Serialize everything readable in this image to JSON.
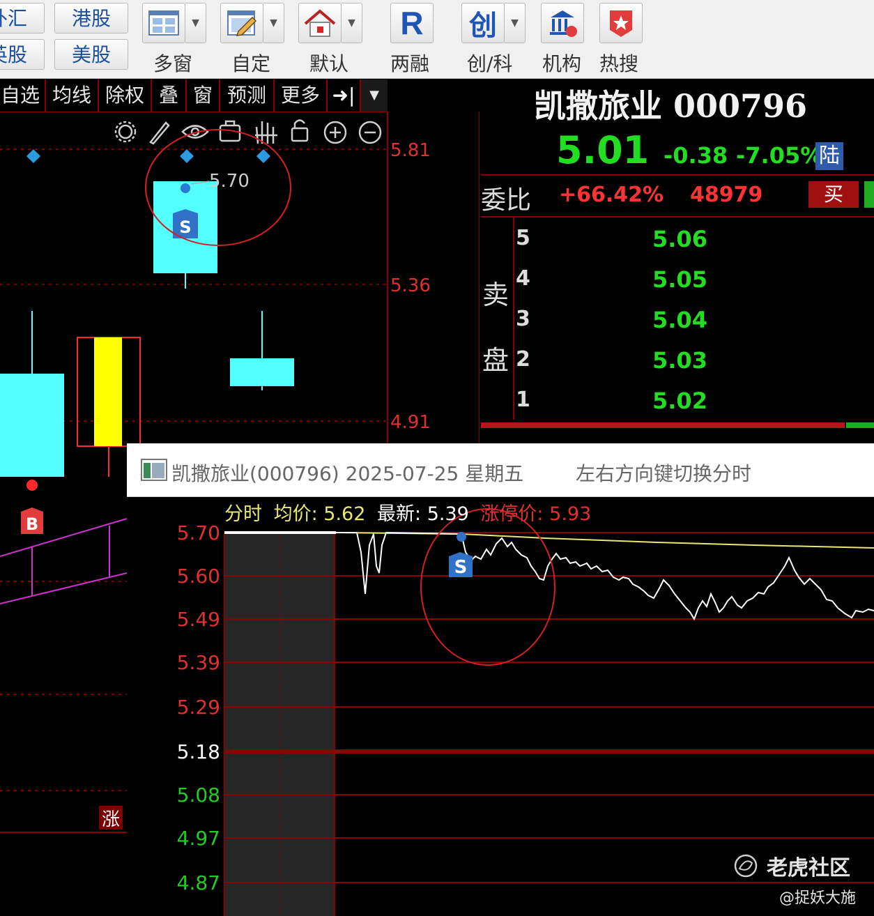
{
  "toolbar": {
    "markets": [
      {
        "label": "外汇"
      },
      {
        "label": "港股"
      },
      {
        "label": "英股"
      },
      {
        "label": "美股"
      }
    ],
    "tools": [
      {
        "label": "多窗",
        "icon": "multi-window-icon",
        "has_dropdown": true
      },
      {
        "label": "自定",
        "icon": "custom-edit-icon",
        "has_dropdown": true
      },
      {
        "label": "默认",
        "icon": "home-icon",
        "has_dropdown": true
      },
      {
        "label": "两融",
        "icon": "margin-r-icon",
        "glyph": "R",
        "has_dropdown": false
      },
      {
        "label": "创/科",
        "icon": "chuang-icon",
        "glyph": "创",
        "has_dropdown": true
      },
      {
        "label": "机构",
        "icon": "institution-icon",
        "has_dropdown": false
      },
      {
        "label": "热搜",
        "icon": "hot-search-icon",
        "has_dropdown": false
      }
    ]
  },
  "chart_tabs": [
    "自选",
    "均线",
    "除权",
    "叠",
    "窗",
    "预测",
    "更多"
  ],
  "kline": {
    "y_labels": [
      "5.81",
      "5.36",
      "4.91"
    ],
    "price_annotation": "5.70",
    "sell_marker": "S",
    "buy_marker": "B",
    "limit_badge": "涨",
    "colors": {
      "up": "#ff2a2a",
      "down": "#54ffff",
      "highlight": "#ffff00",
      "label": "#e03030"
    }
  },
  "quote": {
    "name": "凯撒旅业",
    "code": "000796",
    "price": "5.01",
    "change": "-0.38",
    "change_pct": "-7.05%",
    "connect_badge": "陆",
    "weibi_label": "委比",
    "weibi_pct": "+66.42%",
    "weibi_diff": "48979",
    "buy_label": "买",
    "sell_side_label": [
      "卖",
      "盘"
    ],
    "asks": [
      {
        "level": "5",
        "price": "5.06"
      },
      {
        "level": "4",
        "price": "5.05"
      },
      {
        "level": "3",
        "price": "5.04"
      },
      {
        "level": "2",
        "price": "5.03"
      },
      {
        "level": "1",
        "price": "5.02"
      }
    ]
  },
  "intraday": {
    "title": "凯撒旅业(000796) 2025-07-25 星期五",
    "hint": "左右方向键切换分时",
    "legend": {
      "label": "分时",
      "avg_label": "均价:",
      "avg": "5.62",
      "last_label": "最新:",
      "last": "5.39",
      "limit_label": "涨停价:",
      "limit": "5.93"
    },
    "sell_marker": "S",
    "y_labels": [
      "5.70",
      "5.60",
      "5.49",
      "5.39",
      "5.29",
      "5.18",
      "5.08",
      "4.97",
      "4.87"
    ],
    "colors": {
      "price_line": "#ffffff",
      "avg_line": "#e8e870",
      "grid": "#8b0000",
      "up": "#e03030",
      "down": "#22cc22"
    }
  },
  "watermark": {
    "brand": "老虎社区",
    "author": "@捉妖大施"
  }
}
